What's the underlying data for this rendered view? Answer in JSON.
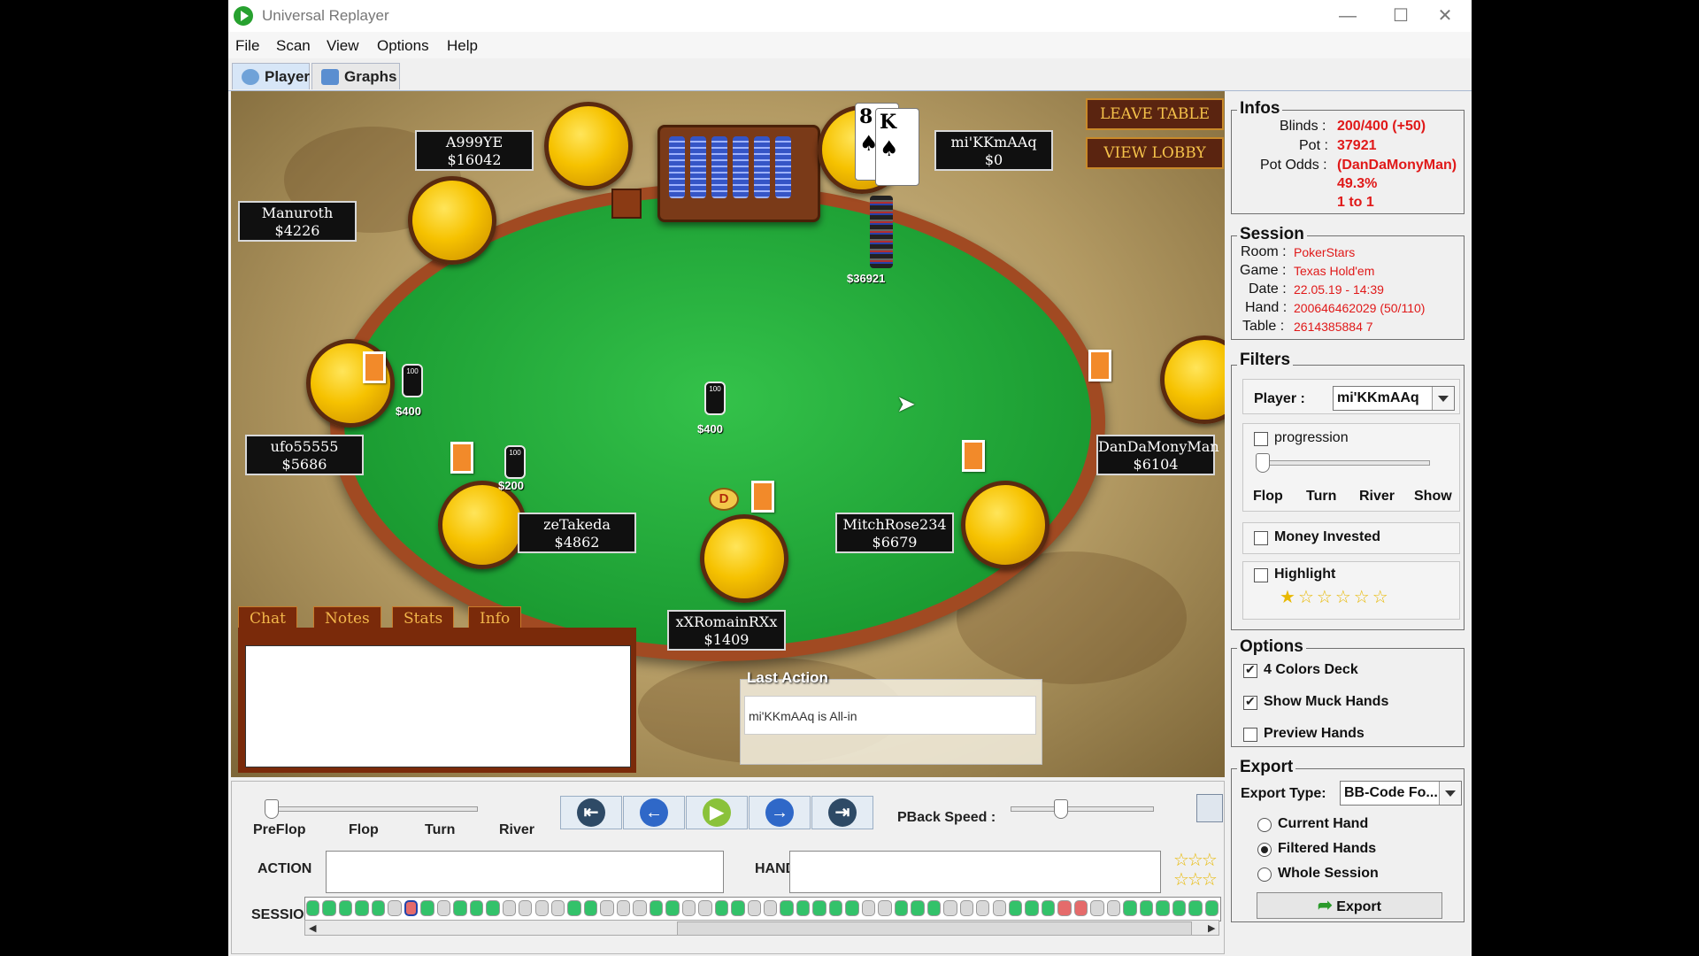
{
  "app": {
    "title": "Universal Replayer"
  },
  "menu": [
    "File",
    "Scan",
    "View",
    "Options",
    "Help"
  ],
  "tabs": [
    {
      "label": "Player",
      "active": true
    },
    {
      "label": "Graphs",
      "active": false
    }
  ],
  "table": {
    "leave_table": "LEAVE TABLE",
    "view_lobby": "VIEW LOBBY",
    "players": [
      {
        "name": "A999YE",
        "stack": "$16042"
      },
      {
        "name": "Manuroth",
        "stack": "$4226"
      },
      {
        "name": "mi'KKmAAq",
        "stack": "$0"
      },
      {
        "name": "ufo55555",
        "stack": "$5686"
      },
      {
        "name": "DanDaMonyMan",
        "stack": "$6104"
      },
      {
        "name": "zeTakeda",
        "stack": "$4862"
      },
      {
        "name": "MitchRose234",
        "stack": "$6679"
      },
      {
        "name": "xXRomainRXx",
        "stack": "$1409"
      }
    ],
    "bets": {
      "left": "$400",
      "center": "$400",
      "lower_left": "$200"
    },
    "chip_label": "100",
    "pot": "$36921",
    "dealer_button": "D",
    "hole_cards": [
      {
        "rank": "8",
        "suit": "♠"
      },
      {
        "rank": "K",
        "suit": "♠"
      }
    ],
    "chat_tabs": [
      "Chat",
      "Notes",
      "Stats",
      "Info"
    ],
    "last_action": {
      "title": "Last Action",
      "text": "mi'KKmAAq is All-in"
    }
  },
  "controls": {
    "streets": [
      "PreFlop",
      "Flop",
      "Turn",
      "River"
    ],
    "street_position": 0,
    "pback_speed_label": "PBack Speed :",
    "pback_speed": 0.35,
    "action_label": "ACTION",
    "hand_label": "HAND",
    "session_label": "SESSION",
    "session_hands": 110,
    "session_current": 6
  },
  "colors": {
    "felt": "#1fa838",
    "rail": "#a14a22",
    "seat": "#f6c200",
    "accent_red": "#e01919",
    "hand_win": "#33c26a",
    "hand_lose": "#e56b6b",
    "hand_empty": "#d8d8d8"
  },
  "infos": {
    "title": "Infos",
    "blinds_label": "Blinds :",
    "blinds": "200/400 (+50)",
    "pot_label": "Pot :",
    "pot": "37921",
    "pot_odds_label": "Pot Odds :",
    "pot_odds_player": "(DanDaMonyMan)",
    "pot_odds_pct": "49.3%",
    "pot_odds_ratio": "1 to 1"
  },
  "session": {
    "title": "Session",
    "room_label": "Room :",
    "room": "PokerStars",
    "game_label": "Game :",
    "game": "Texas Hold'em",
    "date_label": "Date :",
    "date": "22.05.19 - 14:39",
    "hand_label": "Hand :",
    "hand": "200646462029 (50/110)",
    "table_label": "Table :",
    "table": "2614385884 7"
  },
  "filters": {
    "title": "Filters",
    "player_label": "Player :",
    "player_value": "mi'KKmAAq",
    "progression": {
      "label": "progression",
      "checked": false,
      "steps": [
        "Flop",
        "Turn",
        "River",
        "Show"
      ]
    },
    "money_invested": {
      "label": "Money Invested",
      "checked": false
    },
    "highlight": {
      "label": "Highlight",
      "checked": false,
      "stars_filled": 1,
      "stars_total": 6
    }
  },
  "options": {
    "title": "Options",
    "items": [
      {
        "label": "4 Colors Deck",
        "checked": true
      },
      {
        "label": "Show Muck Hands",
        "checked": true
      },
      {
        "label": "Preview Hands",
        "checked": false
      }
    ]
  },
  "export": {
    "title": "Export",
    "type_label": "Export Type:",
    "type_value": "BB-Code Fo...",
    "radios": [
      {
        "label": "Current Hand",
        "selected": false
      },
      {
        "label": "Filtered Hands",
        "selected": true
      },
      {
        "label": "Whole Session",
        "selected": false
      }
    ],
    "button": "Export"
  }
}
